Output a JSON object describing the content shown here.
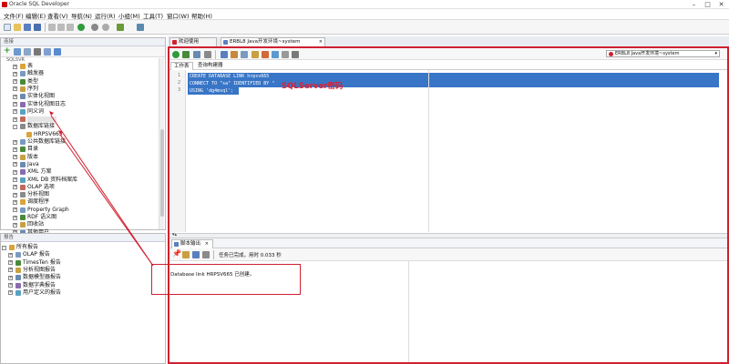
{
  "window": {
    "title": "Oracle SQL Developer"
  },
  "menu": [
    "文件(F)",
    "编辑(E)",
    "查看(V)",
    "导航(N)",
    "运行(R)",
    "小组(M)",
    "工具(T)",
    "窗口(W)",
    "帮助(H)"
  ],
  "connections_panel": {
    "header": "连接",
    "tree": [
      {
        "label": "表",
        "level": 1,
        "toggle": "+",
        "icon": "table-icon"
      },
      {
        "label": "触发器",
        "level": 1,
        "toggle": "+",
        "icon": "trigger-icon"
      },
      {
        "label": "类型",
        "level": 1,
        "toggle": "+",
        "icon": "type-icon"
      },
      {
        "label": "序列",
        "level": 1,
        "toggle": "+",
        "icon": "sequence-icon"
      },
      {
        "label": "实体化视图",
        "level": 1,
        "toggle": "+",
        "icon": "matview-icon"
      },
      {
        "label": "实体化视图日志",
        "level": 1,
        "toggle": "+",
        "icon": "matview-log-icon"
      },
      {
        "label": "同义词",
        "level": 1,
        "toggle": "+",
        "icon": "synonym-icon"
      },
      {
        "label": "",
        "level": 1,
        "toggle": "+",
        "icon": "folder-icon"
      },
      {
        "label": "数据库链接",
        "level": 1,
        "toggle": "-",
        "icon": "db-link-icon"
      },
      {
        "label": "HRPSV665",
        "level": 2,
        "toggle": "",
        "icon": "link-icon"
      },
      {
        "label": "公共数据库链接",
        "level": 1,
        "toggle": "+",
        "icon": "public-db-link-icon"
      },
      {
        "label": "目录",
        "level": 1,
        "toggle": "+",
        "icon": "directory-icon"
      },
      {
        "label": "版本",
        "level": 1,
        "toggle": "+",
        "icon": "edition-icon"
      },
      {
        "label": "Java",
        "level": 1,
        "toggle": "+",
        "icon": "java-icon"
      },
      {
        "label": "XML 方案",
        "level": 1,
        "toggle": "+",
        "icon": "xml-schema-icon"
      },
      {
        "label": "XML DB 资料档案库",
        "level": 1,
        "toggle": "+",
        "icon": "xml-db-icon"
      },
      {
        "label": "OLAP 选项",
        "level": 1,
        "toggle": "+",
        "icon": "olap-icon"
      },
      {
        "label": "分析视图",
        "level": 1,
        "toggle": "+",
        "icon": "analytic-view-icon"
      },
      {
        "label": "调度程序",
        "level": 1,
        "toggle": "+",
        "icon": "scheduler-icon"
      },
      {
        "label": "Property Graph",
        "level": 1,
        "toggle": "+",
        "icon": "property-graph-icon"
      },
      {
        "label": "RDF 语义图",
        "level": 1,
        "toggle": "+",
        "icon": "rdf-icon"
      },
      {
        "label": "回收站",
        "level": 1,
        "toggle": "+",
        "icon": "recycle-bin-icon"
      },
      {
        "label": "其他用户",
        "level": 1,
        "toggle": "+",
        "icon": "other-users-icon"
      }
    ]
  },
  "reports_panel": {
    "header": "报告",
    "tree": [
      {
        "label": "所有报告",
        "level": 0,
        "toggle": "-",
        "icon": "reports-icon"
      },
      {
        "label": "OLAP 报告",
        "level": 1,
        "toggle": "+",
        "icon": "folder-icon"
      },
      {
        "label": "TimesTen 报告",
        "level": 1,
        "toggle": "+",
        "icon": "folder-icon"
      },
      {
        "label": "分析视图报告",
        "level": 1,
        "toggle": "+",
        "icon": "folder-icon"
      },
      {
        "label": "数据模型器报告",
        "level": 1,
        "toggle": "+",
        "icon": "folder-icon"
      },
      {
        "label": "数据字典报告",
        "level": 1,
        "toggle": "+",
        "icon": "folder-icon"
      },
      {
        "label": "用户定义的报告",
        "level": 1,
        "toggle": "+",
        "icon": "folder-icon"
      }
    ]
  },
  "editor": {
    "tabs": [
      {
        "label": "欢迎使用",
        "icon": "welcome-icon",
        "active": false
      },
      {
        "label": "ERBL8 Java开发环境~system",
        "icon": "sql-worksheet-icon",
        "active": true
      }
    ],
    "subtabs": [
      "工作表",
      "查询构建器"
    ],
    "connection": "ERBL8 Java开发环境~system",
    "lines": [
      "CREATE DATABASE LINK hrpsv665",
      "CONNECT TO \"sa\" IDENTIFIED BY \"",
      "USING 'dg4msql';"
    ],
    "annotation": "SQLServer密码"
  },
  "output": {
    "tab": "脚本输出",
    "status": "任务已完成，用时 0.033 秒",
    "message": "Database link HRPSV665 已创建。"
  },
  "colors": {
    "highlight": "#d02030",
    "selection": "#3875c6"
  }
}
